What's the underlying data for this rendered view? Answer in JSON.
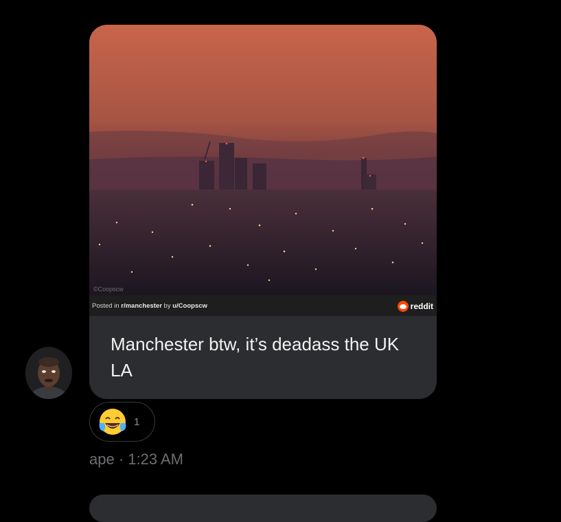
{
  "message": {
    "preview": {
      "watermark": "©Coopscw",
      "posted_prefix": "Posted in ",
      "subreddit": "r/manchester",
      "posted_by_prefix": " by ",
      "author": "u/Coopscw",
      "source_name": "reddit",
      "source_icon": "reddit-logo-icon"
    },
    "text": "Manchester btw, it’s deadass the UK LA",
    "reaction": {
      "emoji": "😂",
      "emoji_icon": "face-with-tears-of-joy-icon",
      "count": "1"
    },
    "sender": "ape",
    "separator": " · ",
    "time": "1:23 AM"
  },
  "colors": {
    "background": "#000000",
    "bubble": "#2c2d30",
    "reddit": "#ff4500",
    "meta_text": "#6e6e73"
  }
}
